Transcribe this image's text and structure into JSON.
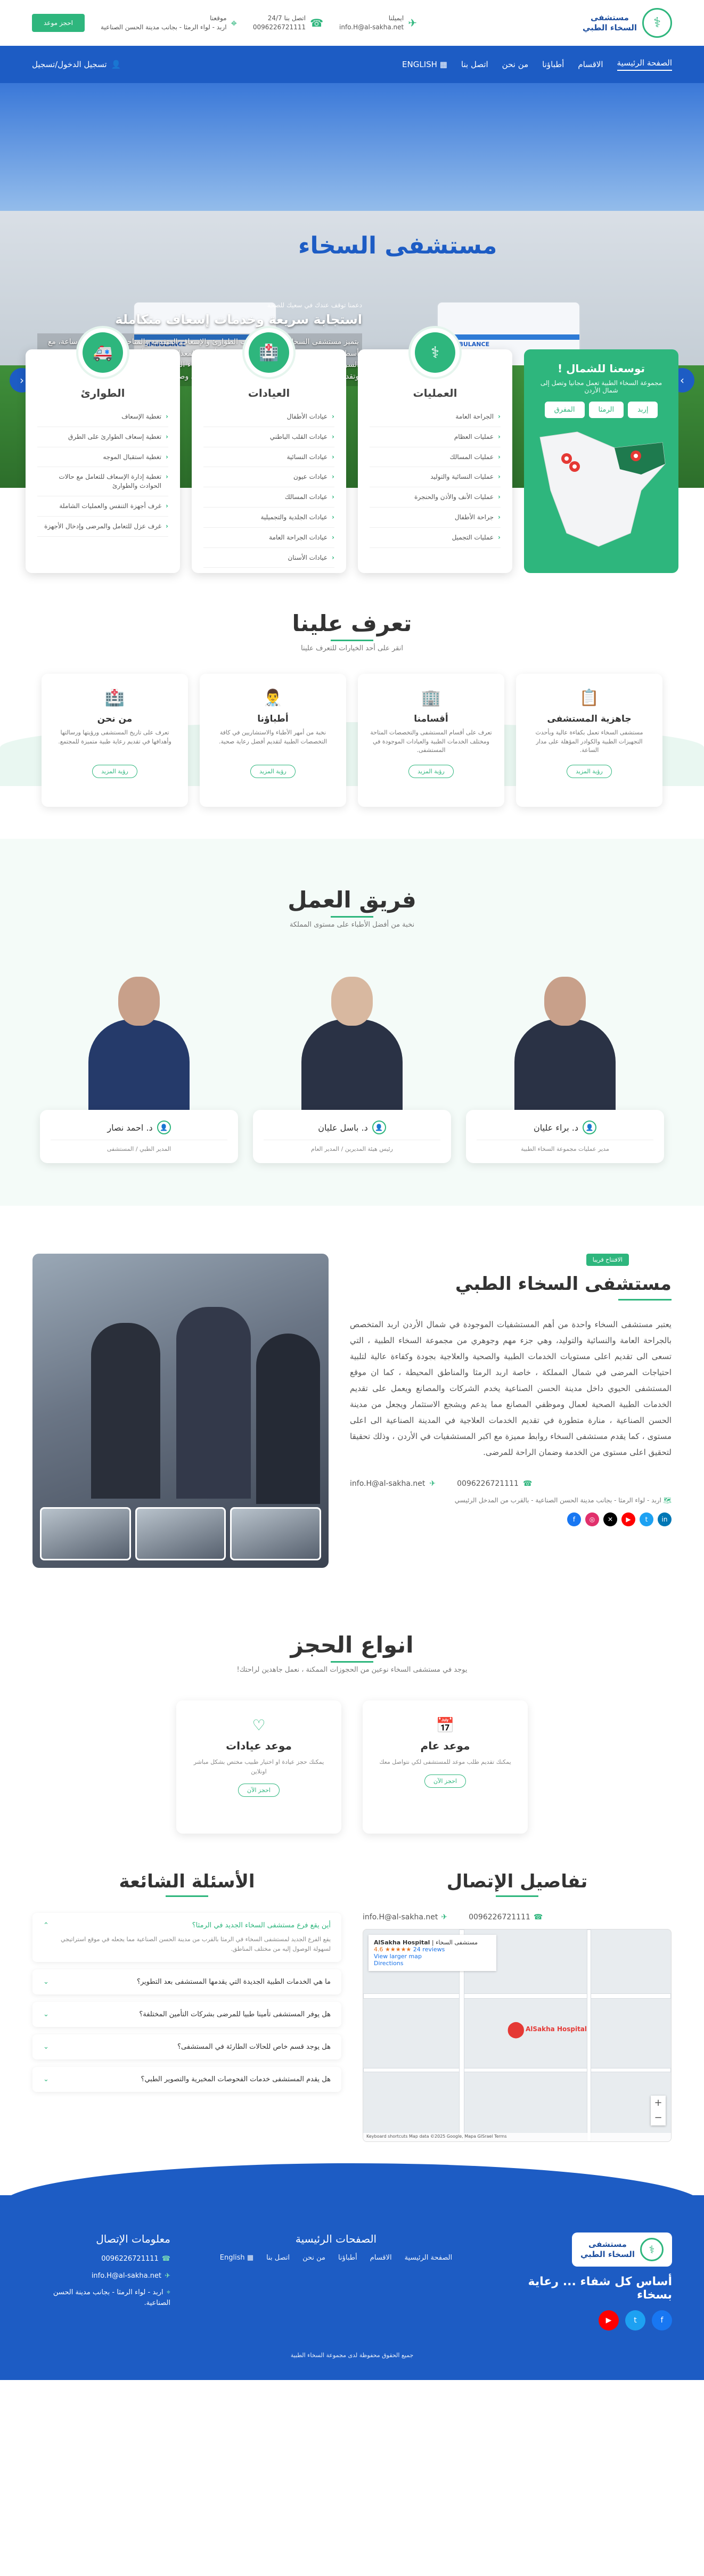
{
  "brand": {
    "name_line1": "مستشفى",
    "name_line2": "السخاء الطبي",
    "logo_icon": "caduceus-icon"
  },
  "topbar": {
    "email_label": "ايميلنا",
    "email": "info.H@al-sakha.net",
    "phone_label": "اتصل بنا 24/7",
    "phone": "0096226721111",
    "location_label": "موقعنا",
    "location": "اربد - لواء الرمثا - بجانب مدينة الحسن الصناعية",
    "book_button": "احجز موعد"
  },
  "nav": {
    "items": [
      "الصفحة الرئيسية",
      "الاقسام",
      "أطباؤنا",
      "من نحن",
      "اتصل بنا",
      "ENGLISH"
    ],
    "login": "تسجيل الدخول/تسجيل"
  },
  "hero": {
    "sub": "دعمنا توقف عندك في سعيك للصحة",
    "title": "استجابة سريعة وخدمات إسعاف متكاملة",
    "desc": "يتميز مستشفى السخاء الطبي بخدمات الطوارئ والإسعاف المتقدمة والمتاحة على مدار 24 ساعة، مع أسطول حديث من سيارات الإسعاف المجهزة بأفضل المعدات الطبية وأحدث التقنيات، نضمن الاستجابة السريعة لأي طارئ طبي، بالقاهم من المسعفين والأطباء المختصين، يستقبلون بكفاءة لإنقاذ الأرواح وتقديم الرعاية الأولية الفورية لضمان أفضل النتائج حتى وصولك إلى المستشفى.",
    "building_sign": "مستشفى السخاء",
    "ambulance_label": "AMBULANCE",
    "prev_arrow": "‹",
    "next_arrow": "›"
  },
  "services": [
    {
      "title": "العمليات",
      "icon": "surgeon-icon",
      "items": [
        "الجراحة العامة",
        "عمليات العظام",
        "عمليات المسالك",
        "عمليات النسائية والتوليد",
        "عمليات الأنف والأذن والحنجرة",
        "جراحة الأطفال",
        "عمليات التجميل"
      ]
    },
    {
      "title": "العيادات",
      "icon": "hospital-icon",
      "items": [
        "عيادات الأطفال",
        "عيادات القلب الباطني",
        "عيادات النسائية",
        "عيادات عيون",
        "عيادات المسالك",
        "عيادات الجلدية والتجميلية",
        "عيادات الجراحة العامة",
        "عيادات الأسنان"
      ]
    },
    {
      "title": "الطوارئ",
      "icon": "ambulance-icon",
      "items": [
        "تغطية الإسعاف",
        "تغطية إسعاف الطوارئ على الطرق",
        "تغطية استقبال الموجه",
        "تغطية إدارة الإسعاف للتعامل مع حالات الحوادث والطوارئ",
        "غرف أجهزة التنفس والعمليات الشاملة",
        "غرف عزل للتعامل والمرضى وإدخال الأجهزة"
      ]
    }
  ],
  "mapcard": {
    "title": "توسعنا للشمال !",
    "desc": "مجموعة السخاء الطبية تعمل مجانيا وتصل إلى شمال الأردن",
    "cities": [
      "إربد",
      "الرمثا",
      "المفرق"
    ]
  },
  "about": {
    "title": "تعرف علينا",
    "sub": "انقر على أحد الخيارات للتعرف علينا",
    "cards": [
      {
        "title": "جاهزية المستشفى",
        "desc": "مستشفى السخاء تعمل بكفاءة عالية وبأحدث التجهيزات الطبية والكوادر المؤهلة على مدار الساعة.",
        "more": "رؤية المزيد",
        "icon": "clipboard-icon"
      },
      {
        "title": "أقسامنا",
        "desc": "تعرف على أقسام المستشفى والتخصصات المتاحة ومختلف الخدمات الطبية والعيادات الموجودة في المستشفى.",
        "more": "رؤية المزيد",
        "icon": "building-icon"
      },
      {
        "title": "أطباؤنا",
        "desc": "نخبة من أمهر الأطباء والاستشاريين في كافة التخصصات الطبية لتقديم أفضل رعاية صحية.",
        "more": "رؤية المزيد",
        "icon": "doctor-icon"
      },
      {
        "title": "من نحن",
        "desc": "تعرف على تاريخ المستشفى ورؤيتها ورسالتها وأهدافها في تقديم رعاية طبية متميزة للمجتمع.",
        "more": "رؤية المزيد",
        "icon": "hospital-icon"
      }
    ]
  },
  "team": {
    "title": "فريق العمل",
    "sub": "نخبة من أفضل الأطباء على مستوى المملكة",
    "members": [
      {
        "name": "د. براء عليان",
        "role": "مدير عمليات مجموعة السخاء الطبية"
      },
      {
        "name": "د. باسل عليان",
        "role": "رئيس هيئة المديرين / المدير العام"
      },
      {
        "name": "د. احمد نصار",
        "role": "المدير الطبي / المستشفى"
      }
    ]
  },
  "hospital": {
    "badge": "الافتتاح قريبا",
    "title": "مستشفى السخاء الطبي",
    "desc": "يعتبر مستشفى السخاء واحدة من أهم المستشفيات الموجودة في شمال الأردن اربد المتخصص بالجراحة العامة والنسائية والتوليد، وهي جزء مهم وجوهري من مجموعة السخاء الطبية ، التي تسعى الى تقديم اعلى مستويات الخدمات الطبية والصحية والعلاجية بجودة وكفاءة عالية لتلبية احتياجات المرضى في شمال المملكة ، خاصة اربد الرمثا والمناطق المحيطة ، كما ان موقع المستشفى الحيوي داخل مدينة الحسن الصناعية يخدم الشركات والمصانع ويعمل على تقديم الخدمات الطبية الصحية لعمال وموظفي المصانع مما يدعم ويشجع الاستثمار ويجعل من مدينة الحسن الصناعية ، منارة متطورة في تقديم الخدمات العلاجية في المدينة الصناعية الى اعلى مستوى ، كما يقدم مستشفى السخاء روابط مميزة مع اكبر المستشفيات في الأردن ، وذلك تحقيقا لتحقيق اعلى مستوى من الخدمة وضمان الراحة للمرضى.",
    "email": "info.H@al-sakha.net",
    "phone": "0096226721111",
    "address": "اربد - لواء الرمثا - بجانب مدينة الحسن الصناعية - بالقرب من المدخل الرئيسي"
  },
  "booking": {
    "title": "انواع الحجز",
    "sub": "يوجد في مستشفى السخاء نوعين من الحجوزات الممكنة ، نعمل جاهدين لراحتك!",
    "cards": [
      {
        "title": "موعد عام",
        "desc": "يمكنك تقديم طلب موعد للمستشفى لكي نتواصل معك",
        "more": "احجز الآن",
        "icon": "calendar-icon"
      },
      {
        "title": "موعد عيادات",
        "desc": "يمكنك حجز عيادة او اختيار طبيب مختص بشكل مباشر اونلاين",
        "more": "احجز الآن",
        "icon": "heart-pulse-icon"
      }
    ]
  },
  "contact": {
    "title": "تفاصيل الإتصال",
    "phone": "0096226721111",
    "email": "info.H@al-sakha.net",
    "map": {
      "place_name": "AlSakha Hospital",
      "place_sub": "مستشفى السخاء",
      "rating": "4.6 ★★★★★",
      "reviews": "24 reviews",
      "view_larger": "View larger map",
      "directions": "Directions",
      "pin_label": "AlSakha Hospital",
      "footer": "Keyboard shortcuts  Map data ©2025 Google, Mapa GISrael  Terms"
    }
  },
  "faq": {
    "title": "الأسئلة الشائعة",
    "open_question": "أين يقع فرع مستشفى السخاء الجديد في الرمثا؟",
    "open_answer": "يقع الفرع الجديد لمستشفى السخاء في الرمثا بالقرب من مدينة الحسن الصناعية مما يجعله في موقع استراتيجي لسهولة الوصول إليه من مختلف المناطق.",
    "questions": [
      "ما هي الخدمات الطبية الجديدة التي يقدمها المستشفى بعد التطوير؟",
      "هل يوفر المستشفى تأمينا طبيا للمرضى بشركات التأمين المختلفة؟",
      "هل يوجد قسم خاص للحالات الطارئة في المستشفى؟",
      "هل يقدم المستشفى خدمات الفحوصات المخبرية والتصوير الطبي؟"
    ]
  },
  "footer": {
    "tagline": "أساس كل شفاء ... رعاية بسخاء",
    "pages_title": "الصفحات الرئيسية",
    "pages": [
      "الصفحة الرئيسية",
      "الاقسام",
      "أطباؤنا",
      "من نحن",
      "اتصل بنا",
      "English"
    ],
    "contact_title": "معلومات الإتصال",
    "phone": "0096226721111",
    "email": "info.H@al-sakha.net",
    "address": "اربد - لواء الرمثا - بجانب مدينة الحسن الصناعية.",
    "copyright": "جميع الحقوق محفوظة لدى مجموعة السخاء الطبية"
  },
  "colors": {
    "primary_blue": "#1d5cc4",
    "accent_green": "#2eb67d"
  }
}
